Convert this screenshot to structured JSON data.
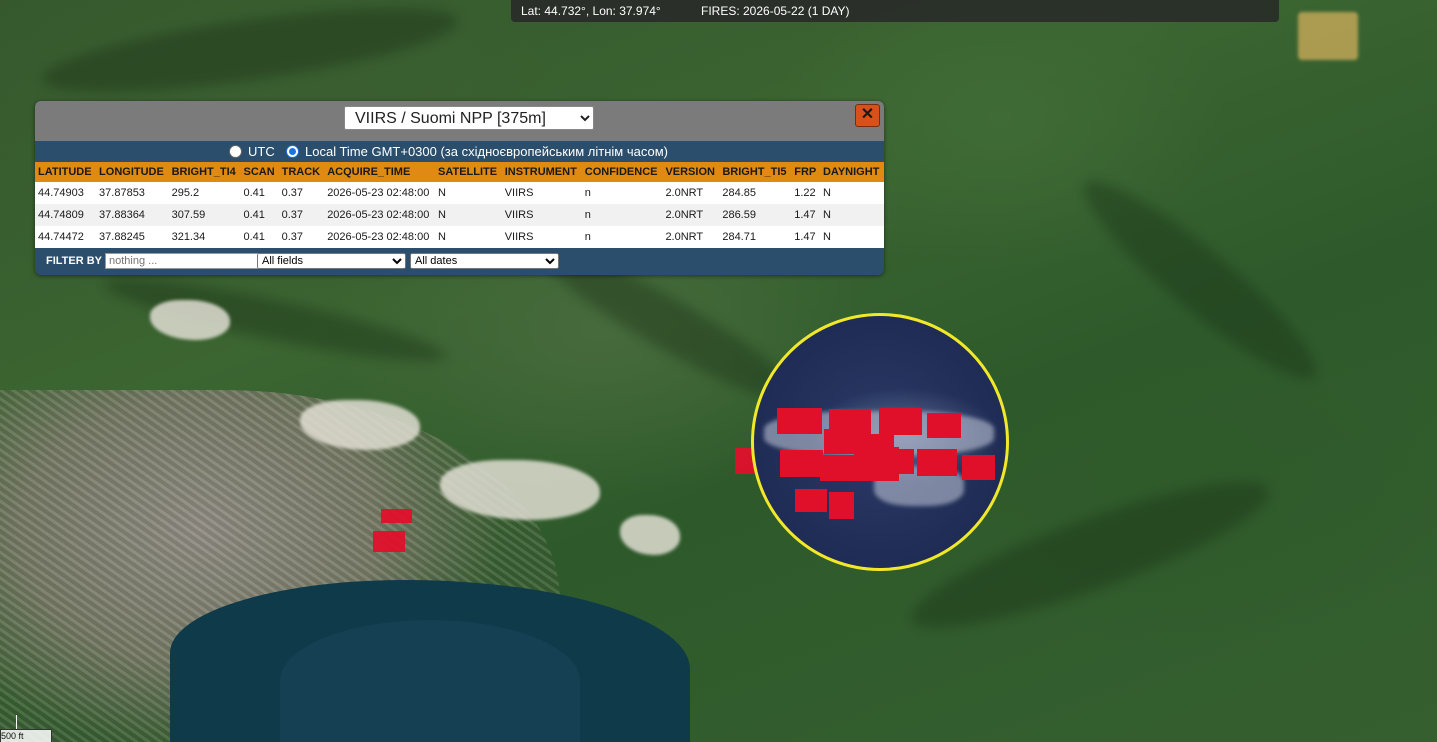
{
  "topbar": {
    "coords": "Lat: 44.732°, Lon: 37.974°",
    "fires": "FIRES: 2026-05-22 (1 DAY)"
  },
  "panel": {
    "source_selected": "VIIRS / Suomi NPP [375m]",
    "close_label": "✕",
    "tz_utc_label": "UTC",
    "tz_local_label": "Local Time GMT+0300 (за східноєвропейським літнім часом)",
    "tz_selected": "local",
    "columns": [
      "LATITUDE",
      "LONGITUDE",
      "BRIGHT_TI4",
      "SCAN",
      "TRACK",
      "ACQUIRE_TIME",
      "SATELLITE",
      "INSTRUMENT",
      "CONFIDENCE",
      "VERSION",
      "BRIGHT_TI5",
      "FRP",
      "DAYNIGHT"
    ],
    "rows": [
      [
        "44.74903",
        "37.87853",
        "295.2",
        "0.41",
        "0.37",
        "2026-05-23 02:48:00",
        "N",
        "VIIRS",
        "n",
        "2.0NRT",
        "284.85",
        "1.22",
        "N"
      ],
      [
        "44.74809",
        "37.88364",
        "307.59",
        "0.41",
        "0.37",
        "2026-05-23 02:48:00",
        "N",
        "VIIRS",
        "n",
        "2.0NRT",
        "286.59",
        "1.47",
        "N"
      ],
      [
        "44.74472",
        "37.88245",
        "321.34",
        "0.41",
        "0.37",
        "2026-05-23 02:48:00",
        "N",
        "VIIRS",
        "n",
        "2.0NRT",
        "284.71",
        "1.47",
        "N"
      ]
    ],
    "filter_label": "FILTER BY",
    "filter_placeholder": "nothing ...",
    "field_selected": "All fields",
    "date_selected": "All dates"
  },
  "scale": {
    "label": "500 ft"
  },
  "colors": {
    "fire": "#e0102b",
    "lens_border": "#f2e82a",
    "header_orange": "#e08a13",
    "panel_blue": "#2a4e6b"
  }
}
